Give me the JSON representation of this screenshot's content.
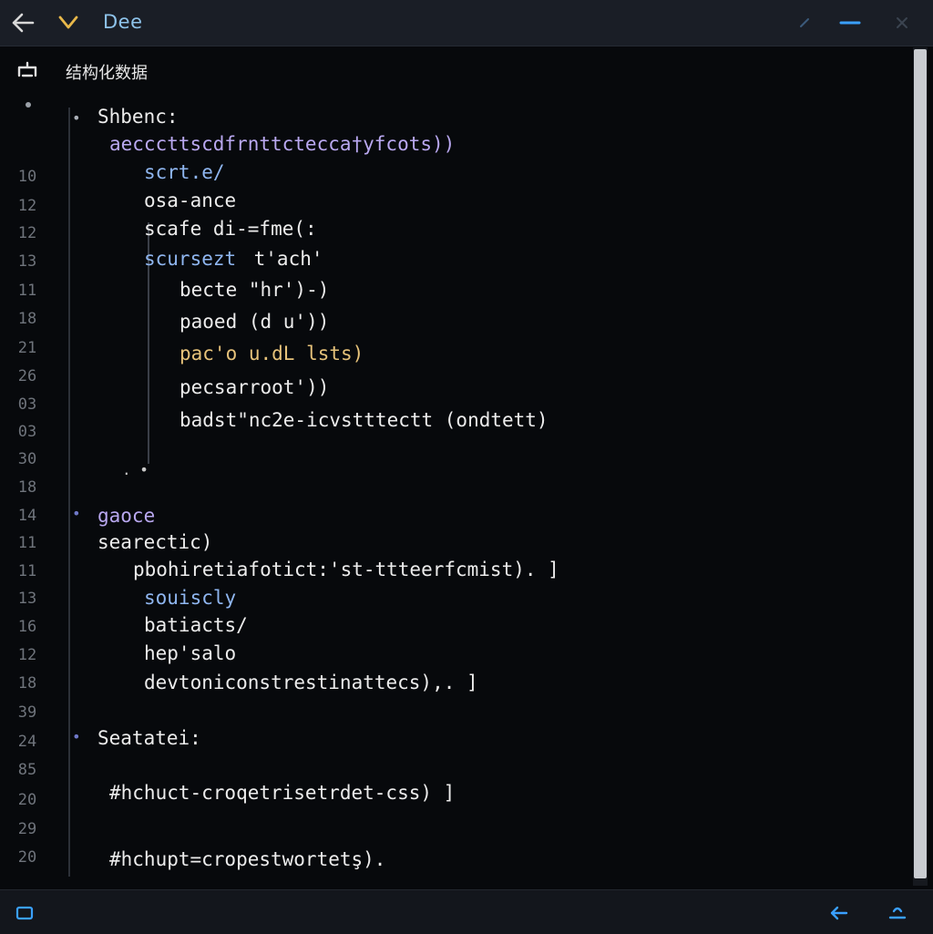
{
  "window": {
    "title": "Dee",
    "icons": [
      "back-arrow-icon",
      "chevron-down-icon",
      "pin-icon",
      "minimize-icon",
      "close-icon"
    ]
  },
  "header": {
    "title": "结构化数据"
  },
  "colors": {
    "background": "#07090c",
    "titlebar": "#1a1e26",
    "accent": "#3aa0ff",
    "keyword": "#8fb6f0",
    "string": "#e6c27a"
  },
  "gutter": {
    "line_numbers": [
      "10",
      "12",
      "12",
      "13",
      "11",
      "18",
      "21",
      "26",
      "03",
      "03",
      "30",
      "18",
      "14",
      "11",
      "11",
      "13",
      "16",
      "12",
      "18",
      "39",
      "24",
      "85",
      "20",
      "29",
      "20"
    ]
  },
  "code": {
    "section1_label": "Shbenc:",
    "section1_line1": "aecccttscdfrnttctecca†yfcots))",
    "s1_l2": "scrt.e/",
    "s1_l3": "osa-ance",
    "s1_l4": "scafe di-=fme(:",
    "s1_l5a": "scursezt",
    "s1_l5b": " t'ach'",
    "s1_l6": "becte \"hr')-)",
    "s1_l7": "paoed (d u'))",
    "s1_l8": "pac'o u.dL lsts)",
    "s1_l9": "pecsarroot'))",
    "s1_l10": "badst\"nc2e-icvstttectt (ondtett)",
    "section2_label": "gaoce",
    "s2_l1": "searectic)",
    "s2_l2": "pbohiretiafotict:'st-ttteerfcmist). ]",
    "s2_l3": "souiscly",
    "s2_l4": "batiacts/",
    "s2_l5": "hep'salo",
    "s2_l6": "devtoniconstrestinattecs),. ]",
    "section3_label": "Seatatei:",
    "s3_l1": "#hchuct-croqetrisetrdet-css) ]",
    "s3_l2": "#hchupt=cropestwortetş)."
  },
  "status": {
    "icons": [
      "panel-icon",
      "back-arrow-icon",
      "user-icon"
    ]
  }
}
